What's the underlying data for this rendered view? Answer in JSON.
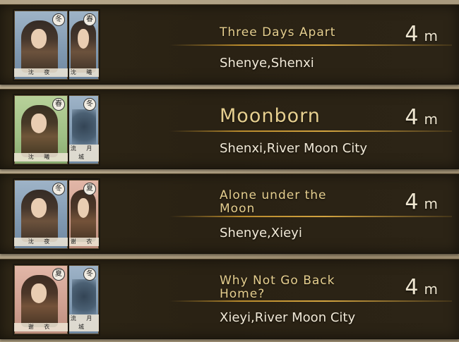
{
  "entries": [
    {
      "title": "Three Days Apart",
      "duration": "4",
      "unit": "m",
      "characters": "Shenye,Shenxi",
      "card_left": {
        "season": "冬",
        "name": "沈 夜",
        "bg": "winter"
      },
      "card_right": {
        "season": "春",
        "name": "沈 曦",
        "bg": "winter"
      }
    },
    {
      "title": "Moonborn",
      "duration": "4",
      "unit": "m",
      "characters": "Shenxi,River Moon City",
      "card_left": {
        "season": "春",
        "name": "沈 曦",
        "bg": "spring"
      },
      "card_right": {
        "season": "冬",
        "name": "流 月 城",
        "bg": "winter"
      }
    },
    {
      "title": "Alone under the Moon",
      "duration": "4",
      "unit": "m",
      "characters": "Shenye,Xieyi",
      "card_left": {
        "season": "冬",
        "name": "沈 夜",
        "bg": "winter"
      },
      "card_right": {
        "season": "夏",
        "name": "谢 衣",
        "bg": "summer"
      }
    },
    {
      "title": "Why Not Go Back Home?",
      "duration": "4",
      "unit": "m",
      "characters": "Xieyi,River Moon City",
      "card_left": {
        "season": "夏",
        "name": "谢 衣",
        "bg": "summer"
      },
      "card_right": {
        "season": "冬",
        "name": "流 月 城",
        "bg": "winter"
      }
    }
  ]
}
